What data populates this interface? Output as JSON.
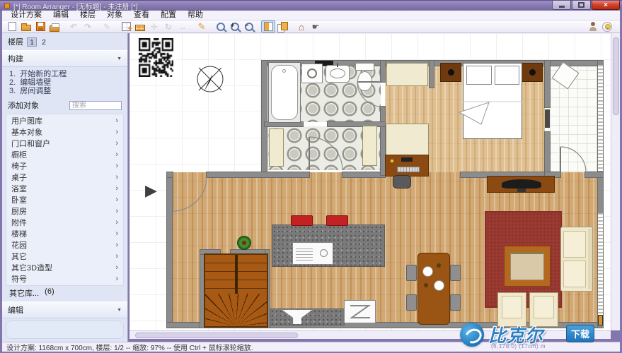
{
  "window": {
    "title": "[*] Room Arranger - [无标题] - 未注册 [*]",
    "close_glyph": "×"
  },
  "menu": {
    "items": [
      "设计方案",
      "编辑",
      "楼层",
      "对象",
      "查看",
      "配置",
      "帮助"
    ]
  },
  "toolbar": {
    "icons": [
      {
        "name": "new-document"
      },
      {
        "name": "open-project"
      },
      {
        "name": "save"
      },
      {
        "name": "print"
      },
      {
        "name": "undo",
        "glyph": "↶",
        "disabled": true
      },
      {
        "name": "redo",
        "glyph": "↷",
        "disabled": true
      },
      {
        "name": "paint-style",
        "glyph": "✎",
        "disabled": true
      },
      {
        "name": "insert-room"
      },
      {
        "name": "wall-tool"
      },
      {
        "name": "move-tool",
        "glyph": "✛",
        "disabled": true
      },
      {
        "name": "rotate-tool",
        "glyph": "↻",
        "disabled": true
      },
      {
        "name": "dimension-tool",
        "glyph": "↔",
        "disabled": true
      },
      {
        "name": "draw-pencil",
        "glyph": "✎",
        "gclass": "pencil"
      },
      {
        "name": "zoom-to-fit",
        "kind": "mag"
      },
      {
        "name": "zoom-in",
        "kind": "mag",
        "glyph": "+"
      },
      {
        "name": "zoom-out",
        "kind": "mag",
        "glyph": "−"
      },
      {
        "name": "toggle-sidebar",
        "pressed": true
      },
      {
        "name": "duplicate-view"
      },
      {
        "name": "view-3d",
        "glyph": "⌂",
        "gclass": "house"
      },
      {
        "name": "walkthrough",
        "glyph": "☛"
      }
    ],
    "right_icons": [
      {
        "name": "user-hint"
      },
      {
        "name": "tip-lightbulb"
      }
    ]
  },
  "sidebar": {
    "floors_label": "楼层",
    "floor_tabs": [
      "1",
      "2"
    ],
    "active_floor_index": 0,
    "build_header": "构建",
    "build_steps": [
      "1.  开始新的工程",
      "2.  编辑墙壁",
      "3.  房间调整"
    ],
    "add_objects_header": "添加对象",
    "search_placeholder": "搜索",
    "categories": [
      "用户图库",
      "基本对象",
      "门口和窗户",
      "橱柜",
      "椅子",
      "桌子",
      "浴室",
      "卧室",
      "厨房",
      "附件",
      "楼梯",
      "花园",
      "其它",
      "其它3D造型",
      "符号"
    ],
    "chevron": "›",
    "collapse_glyph": "▼",
    "other_libs_label": "其它库...",
    "other_libs_count": "(6)",
    "edit_header": "编辑"
  },
  "canvas": {
    "collapse_arrow": "▶"
  },
  "statusbar": {
    "text": "设计方案: 1168cm x 700cm, 楼层: 1/2 -- 缩放: 97% -- 使用 Ctrl + 鼠标滚轮缩放."
  },
  "watermark": {
    "brand": "比克尔",
    "badge": "下载",
    "subtext": "(6,178.0)  (17cm) m"
  },
  "colors": {
    "accent_orange": "#e8932c",
    "titlebar_purple": "#8376ad",
    "wood": "#d2a873",
    "carpet_red": "#9b3a31",
    "stool_red": "#c32222",
    "brand_blue": "#2a7fc4"
  }
}
